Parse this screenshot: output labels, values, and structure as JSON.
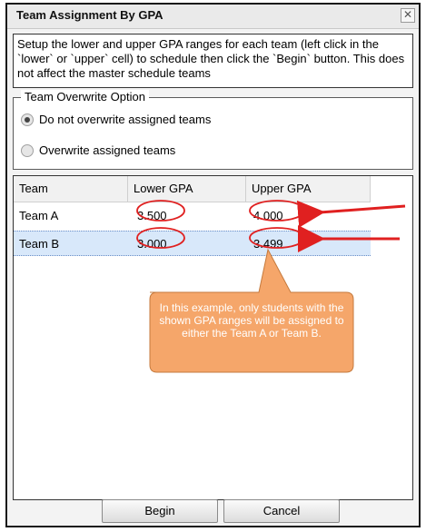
{
  "dialog": {
    "title": "Team Assignment By GPA",
    "close_glyph": "✕",
    "instructions": "Setup the lower and upper GPA ranges for each team (left click in the `lower` or `upper` cell) to schedule then click the `Begin` button. This does not affect the master schedule teams"
  },
  "overwrite": {
    "legend": "Team Overwrite Option",
    "options": [
      {
        "label": "Do not overwrite assigned teams",
        "selected": true
      },
      {
        "label": "Overwrite assigned teams",
        "selected": false
      }
    ]
  },
  "grid": {
    "columns": [
      "Team",
      "Lower GPA",
      "Upper GPA"
    ],
    "rows": [
      {
        "team": "Team A",
        "lower": "3.500",
        "upper": "4.000",
        "selected": false
      },
      {
        "team": "Team B",
        "lower": "3.000",
        "upper": "3.499",
        "selected": true
      }
    ]
  },
  "annotation": {
    "callout": "In this example, only students with the shown GPA ranges will be assigned to either the Team A or Team B.",
    "callout_color": "#f5a66a",
    "arrow_color": "#e02020",
    "circle_color": "#e02020"
  },
  "footer": {
    "begin_label": "Begin",
    "cancel_label": "Cancel"
  }
}
